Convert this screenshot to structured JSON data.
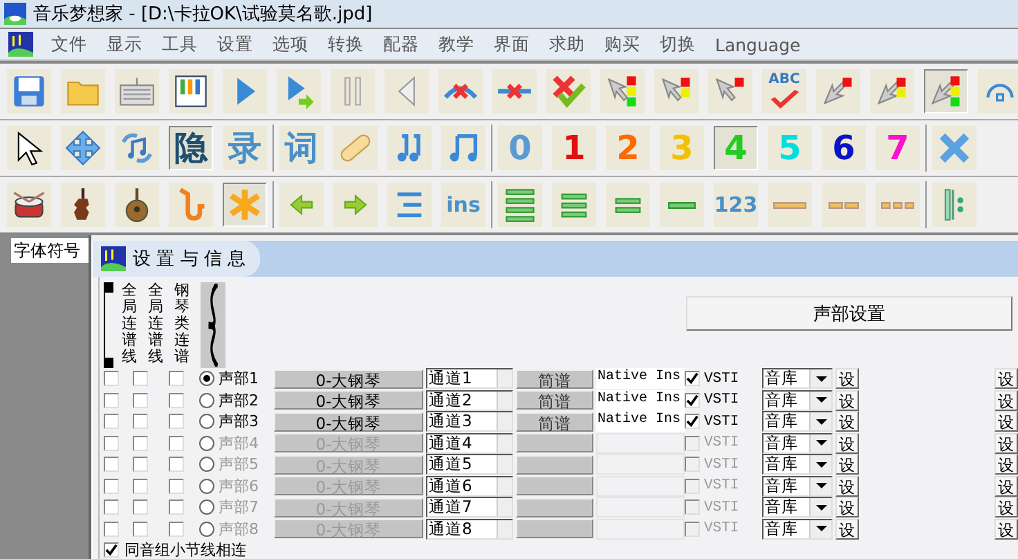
{
  "window": {
    "title": "音乐梦想家 - [D:\\卡拉OK\\试验莫名歌.jpd]"
  },
  "menu": {
    "items": [
      "文件",
      "显示",
      "工具",
      "设置",
      "选项",
      "转换",
      "配器",
      "教学",
      "界面",
      "求助",
      "购买",
      "切换",
      "Language"
    ]
  },
  "toolbars": [
    {
      "items": [
        {
          "kind": "icon",
          "selected": false
        },
        {
          "kind": "icon",
          "selected": false
        },
        {
          "kind": "icon",
          "selected": false
        },
        {
          "kind": "icon",
          "selected": false
        },
        {
          "kind": "icon",
          "selected": false
        },
        {
          "kind": "icon",
          "selected": false
        },
        {
          "kind": "icon",
          "selected": false
        },
        {
          "kind": "icon",
          "selected": false
        },
        {
          "kind": "icon",
          "selected": false
        },
        {
          "kind": "icon",
          "selected": false
        },
        {
          "kind": "icon",
          "selected": false
        },
        {
          "kind": "icon",
          "selected": false
        },
        {
          "kind": "icon",
          "selected": false
        },
        {
          "kind": "icon",
          "selected": false
        },
        {
          "kind": "spell",
          "text": "ABC",
          "selected": false
        },
        {
          "kind": "icon",
          "selected": false
        },
        {
          "kind": "icon",
          "selected": false
        },
        {
          "kind": "icon",
          "selected": true
        },
        {
          "kind": "icon",
          "selected": false
        }
      ]
    },
    {
      "items": [
        {
          "kind": "icon",
          "selected": false
        },
        {
          "kind": "icon",
          "selected": false
        },
        {
          "kind": "icon",
          "selected": false
        },
        {
          "kind": "text",
          "text": "隐",
          "color": "#1d4f6e",
          "selected": true
        },
        {
          "kind": "text",
          "text": "录",
          "color": "#4a90c8",
          "selected": false
        },
        {
          "kind": "separator"
        },
        {
          "kind": "text",
          "text": "词",
          "color": "#4a90c8",
          "selected": false
        },
        {
          "kind": "icon",
          "selected": false
        },
        {
          "kind": "icon",
          "selected": false
        },
        {
          "kind": "icon",
          "selected": false
        },
        {
          "kind": "separator"
        },
        {
          "kind": "text",
          "text": "0",
          "color": "#5b9bd5",
          "selected": false
        },
        {
          "kind": "text",
          "text": "1",
          "color": "#e41010",
          "selected": false
        },
        {
          "kind": "text",
          "text": "2",
          "color": "#ff6a00",
          "selected": false
        },
        {
          "kind": "text",
          "text": "3",
          "color": "#f5c000",
          "selected": false
        },
        {
          "kind": "text",
          "text": "4",
          "color": "#22cc22",
          "selected": true
        },
        {
          "kind": "text",
          "text": "5",
          "color": "#00dede",
          "selected": false
        },
        {
          "kind": "text",
          "text": "6",
          "color": "#0a14c8",
          "selected": false
        },
        {
          "kind": "text",
          "text": "7",
          "color": "#ff10cc",
          "selected": false
        },
        {
          "kind": "separator"
        },
        {
          "kind": "icon",
          "selected": false
        }
      ]
    },
    {
      "items": [
        {
          "kind": "icon",
          "selected": false
        },
        {
          "kind": "icon",
          "selected": false
        },
        {
          "kind": "icon",
          "selected": false
        },
        {
          "kind": "icon",
          "selected": false
        },
        {
          "kind": "icon",
          "selected": true
        },
        {
          "kind": "separator"
        },
        {
          "kind": "icon",
          "selected": false
        },
        {
          "kind": "icon",
          "selected": false
        },
        {
          "kind": "icon",
          "selected": false
        },
        {
          "kind": "text",
          "text": "ins",
          "color": "#4a90c8",
          "selected": false
        },
        {
          "kind": "separator"
        },
        {
          "kind": "icon",
          "selected": false
        },
        {
          "kind": "icon",
          "selected": false
        },
        {
          "kind": "icon",
          "selected": false
        },
        {
          "kind": "icon",
          "selected": false
        },
        {
          "kind": "text",
          "text": "123",
          "color": "#4a90c8",
          "selected": false
        },
        {
          "kind": "icon",
          "selected": false
        },
        {
          "kind": "icon",
          "selected": false
        },
        {
          "kind": "icon",
          "selected": false
        },
        {
          "kind": "separator"
        },
        {
          "kind": "icon",
          "selected": false
        }
      ]
    }
  ],
  "side_tabs": [
    {
      "label": "字体符号",
      "selected": true
    }
  ],
  "settings_panel": {
    "title": "设 置 与 信 息",
    "column_headers": [
      "全局连谱线",
      "全局连谱线",
      "钢琴类连谱"
    ],
    "voice_settings_button": "声部设置",
    "voices": [
      {
        "label": "声部1",
        "selected": true,
        "disabled": false,
        "link_1": false,
        "link_2": false,
        "link_3": false,
        "instrument": "0-大钢琴",
        "channel": "通道1",
        "notation": "简谱",
        "plugin": "Native Ins",
        "vsti": true,
        "vsti_label": "VSTI",
        "library": "音库",
        "setup": "设",
        "setup_2": "设"
      },
      {
        "label": "声部2",
        "selected": false,
        "disabled": false,
        "link_1": false,
        "link_2": false,
        "link_3": false,
        "instrument": "0-大钢琴",
        "channel": "通道2",
        "notation": "简谱",
        "plugin": "Native Ins",
        "vsti": true,
        "vsti_label": "VSTI",
        "library": "音库",
        "setup": "设",
        "setup_2": "设"
      },
      {
        "label": "声部3",
        "selected": false,
        "disabled": false,
        "link_1": false,
        "link_2": false,
        "link_3": false,
        "instrument": "0-大钢琴",
        "channel": "通道3",
        "notation": "简谱",
        "plugin": "Native Ins",
        "vsti": true,
        "vsti_label": "VSTI",
        "library": "音库",
        "setup": "设",
        "setup_2": "设"
      },
      {
        "label": "声部4",
        "selected": false,
        "disabled": true,
        "link_1": false,
        "link_2": false,
        "link_3": false,
        "instrument": "0-大钢琴",
        "channel": "通道4",
        "vsti": false,
        "vsti_label": "VSTI",
        "library": "音库",
        "setup": "设",
        "setup_2": "设"
      },
      {
        "label": "声部5",
        "selected": false,
        "disabled": true,
        "link_1": false,
        "link_2": false,
        "link_3": false,
        "instrument": "0-大钢琴",
        "channel": "通道5",
        "vsti": false,
        "vsti_label": "VSTI",
        "library": "音库",
        "setup": "设",
        "setup_2": "设"
      },
      {
        "label": "声部6",
        "selected": false,
        "disabled": true,
        "link_1": false,
        "link_2": false,
        "link_3": false,
        "instrument": "0-大钢琴",
        "channel": "通道6",
        "vsti": false,
        "vsti_label": "VSTI",
        "library": "音库",
        "setup": "设",
        "setup_2": "设"
      },
      {
        "label": "声部7",
        "selected": false,
        "disabled": true,
        "link_1": false,
        "link_2": false,
        "link_3": false,
        "instrument": "0-大钢琴",
        "channel": "通道7",
        "vsti": false,
        "vsti_label": "VSTI",
        "library": "音库",
        "setup": "设",
        "setup_2": "设"
      },
      {
        "label": "声部8",
        "selected": false,
        "disabled": true,
        "link_1": false,
        "link_2": false,
        "link_3": false,
        "instrument": "0-大钢琴",
        "channel": "通道8",
        "vsti": false,
        "vsti_label": "VSTI",
        "library": "音库",
        "setup": "设",
        "setup_2": "设"
      }
    ],
    "bar_link_option": {
      "label": "同音组小节线相连",
      "checked": true
    }
  }
}
